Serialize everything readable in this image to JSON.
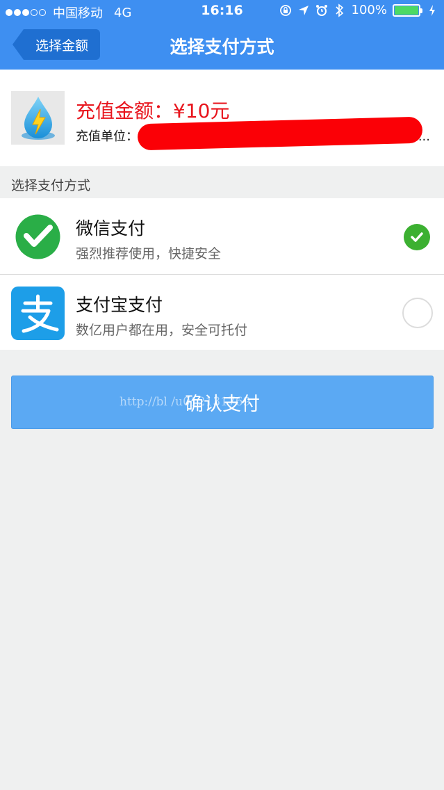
{
  "status_bar": {
    "carrier": "中国移动",
    "network": "4G",
    "time": "16:16",
    "battery_percent": "100%",
    "battery_level": 1.0
  },
  "nav": {
    "back_label": "选择金额",
    "title": "选择支付方式"
  },
  "product": {
    "amount_label": "充值金额：¥10元",
    "unit_label": "充值单位：",
    "ellipsis": "..."
  },
  "section": {
    "label": "选择支付方式"
  },
  "payment_methods": [
    {
      "name": "微信支付",
      "description": "强烈推荐使用，快捷安全",
      "selected": true,
      "icon": "wechat-pay-icon",
      "color": "#2aae47"
    },
    {
      "name": "支付宝支付",
      "description": "数亿用户都在用，安全可托付",
      "selected": false,
      "icon": "alipay-icon",
      "color": "#1d9ee8"
    }
  ],
  "confirm_button": {
    "label": "确认支付"
  },
  "watermark": "http://bl          /u012131769",
  "colors": {
    "nav_bg": "#3e8ff1",
    "amount_red": "#e8151d",
    "button_blue": "#5ba9f3",
    "check_green": "#3cb031"
  }
}
